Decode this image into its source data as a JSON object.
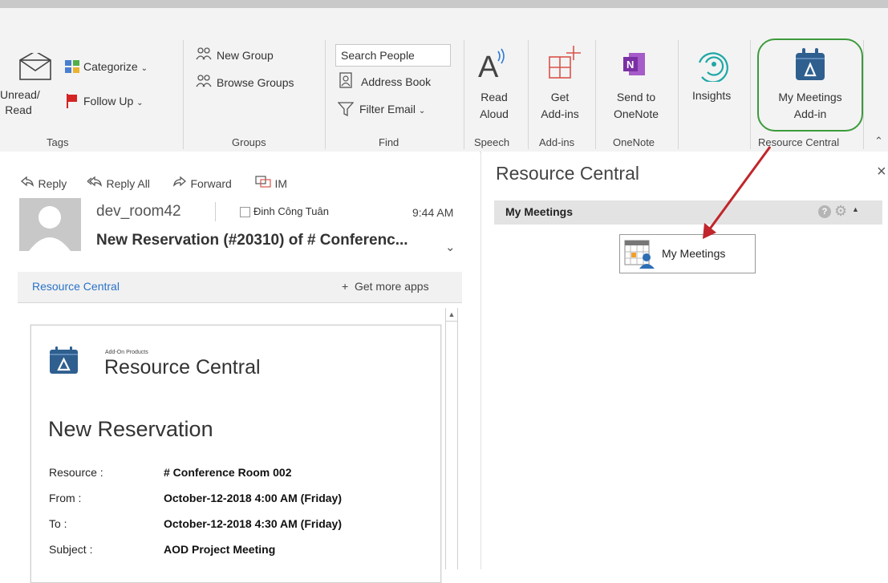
{
  "ribbon": {
    "tags": {
      "unread_read": "Unread/\nRead",
      "categorize": "Categorize",
      "follow_up": "Follow Up",
      "group_label": "Tags"
    },
    "groups": {
      "new_group": "New Group",
      "browse_groups": "Browse Groups",
      "group_label": "Groups"
    },
    "find": {
      "search_placeholder": "Search People",
      "address_book": "Address Book",
      "filter_email": "Filter Email",
      "group_label": "Find"
    },
    "speech": {
      "read_aloud_line1": "Read",
      "read_aloud_line2": "Aloud",
      "group_label": "Speech"
    },
    "addins": {
      "get_addins_line1": "Get",
      "get_addins_line2": "Add-ins",
      "group_label": "Add-ins"
    },
    "onenote": {
      "send_line1": "Send to",
      "send_line2": "OneNote",
      "group_label": "OneNote"
    },
    "insights": {
      "label": "Insights"
    },
    "resource_central": {
      "line1": "My Meetings",
      "line2": "Add-in",
      "group_label": "Resource Central"
    },
    "highlight_color": "#3c9a3c",
    "accent_color": "#2f5f8f"
  },
  "message": {
    "actions": {
      "reply": "Reply",
      "reply_all": "Reply All",
      "forward": "Forward",
      "im": "IM"
    },
    "sender": "dev_room42",
    "recipient": "Đinh Công Tuân",
    "time": "9:44 AM",
    "subject": "New Reservation (#20310) of # Conferenc...",
    "addin_bar": {
      "name": "Resource Central",
      "get_more": "Get more apps"
    }
  },
  "email_body": {
    "brand_small": "Add-On Products",
    "brand_title": "Resource Central",
    "heading": "New Reservation",
    "fields": [
      {
        "label": "Resource :",
        "value": "# Conference Room 002"
      },
      {
        "label": "From :",
        "value": "October-12-2018 4:00 AM (Friday)"
      },
      {
        "label": "To :",
        "value": "October-12-2018 4:30 AM (Friday)"
      },
      {
        "label": "Subject :",
        "value": "AOD Project Meeting"
      }
    ]
  },
  "task_pane": {
    "title": "Resource Central",
    "close": "×",
    "section_title": "My Meetings",
    "button_label": "My Meetings"
  },
  "annotation": {
    "arrow_color": "#c0262b"
  }
}
